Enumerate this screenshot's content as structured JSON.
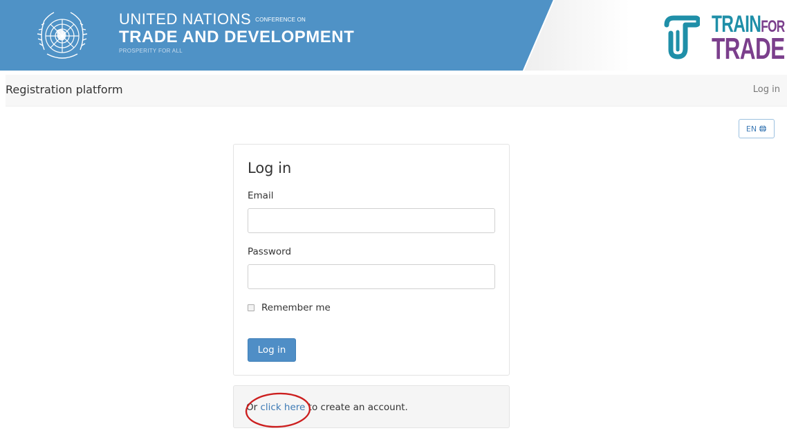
{
  "banner": {
    "un_line1": "UNITED NATIONS",
    "un_conference": "CONFERENCE ON",
    "un_line2": "TRADE AND DEVELOPMENT",
    "un_tagline": "PROSPERITY FOR ALL",
    "t4t_train": "TRAIN",
    "t4t_for": "FOR",
    "t4t_trade": "TRADE",
    "colors": {
      "blue": "#4f92c6",
      "teal": "#1f8fa8",
      "purple": "#7b3f8c"
    }
  },
  "navbar": {
    "brand": "Registration platform",
    "login_link": "Log in"
  },
  "language": {
    "label": "EN",
    "icon": "globe-icon"
  },
  "login_form": {
    "title": "Log in",
    "email_label": "Email",
    "email_value": "",
    "password_label": "Password",
    "password_value": "",
    "remember_label": "Remember me",
    "remember_checked": false,
    "submit_label": "Log in"
  },
  "register_note": {
    "prefix": "Or ",
    "link": "click here",
    "suffix": " to create an account."
  }
}
